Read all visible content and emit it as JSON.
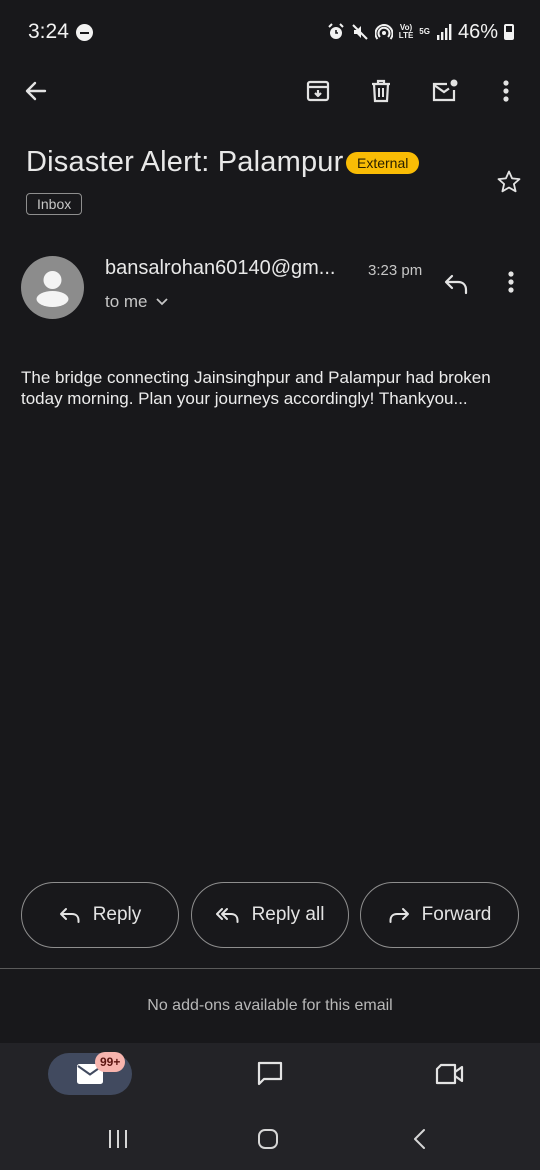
{
  "status_bar": {
    "time": "3:24",
    "battery": "46%",
    "icons": [
      "dnd-icon",
      "alarm-icon",
      "mute-icon",
      "hotspot-icon",
      "volte-icon",
      "5g-icon",
      "signal-icon",
      "battery-icon"
    ],
    "volte_label": "Vo)) LTE",
    "network_label": "5G"
  },
  "toolbar": {
    "icons": [
      "back-arrow-icon",
      "archive-icon",
      "delete-icon",
      "mark-unread-icon",
      "more-vert-icon"
    ]
  },
  "email": {
    "subject": "Disaster Alert: Palampur",
    "external_label": "External",
    "folder_label": "Inbox",
    "sender": "bansalrohan60140@gm...",
    "time": "3:23 pm",
    "recipient": "to me",
    "body": "The bridge connecting Jainsinghpur and Palampur had broken today morning. Plan your journeys accordingly! Thankyou..."
  },
  "actions": {
    "reply": "Reply",
    "reply_all": "Reply all",
    "forward": "Forward"
  },
  "addons_text": "No add-ons available for this email",
  "bottom_nav": {
    "mail_badge": "99+",
    "items": [
      "mail-icon",
      "chat-icon",
      "meet-icon"
    ]
  },
  "system_nav": {
    "items": [
      "recents-icon",
      "home-icon",
      "back-icon"
    ]
  },
  "colors": {
    "background": "#18181b",
    "external_badge": "#f9bc05",
    "mail_nav_pill": "#414a5f",
    "badge": "#f7b4ae"
  }
}
